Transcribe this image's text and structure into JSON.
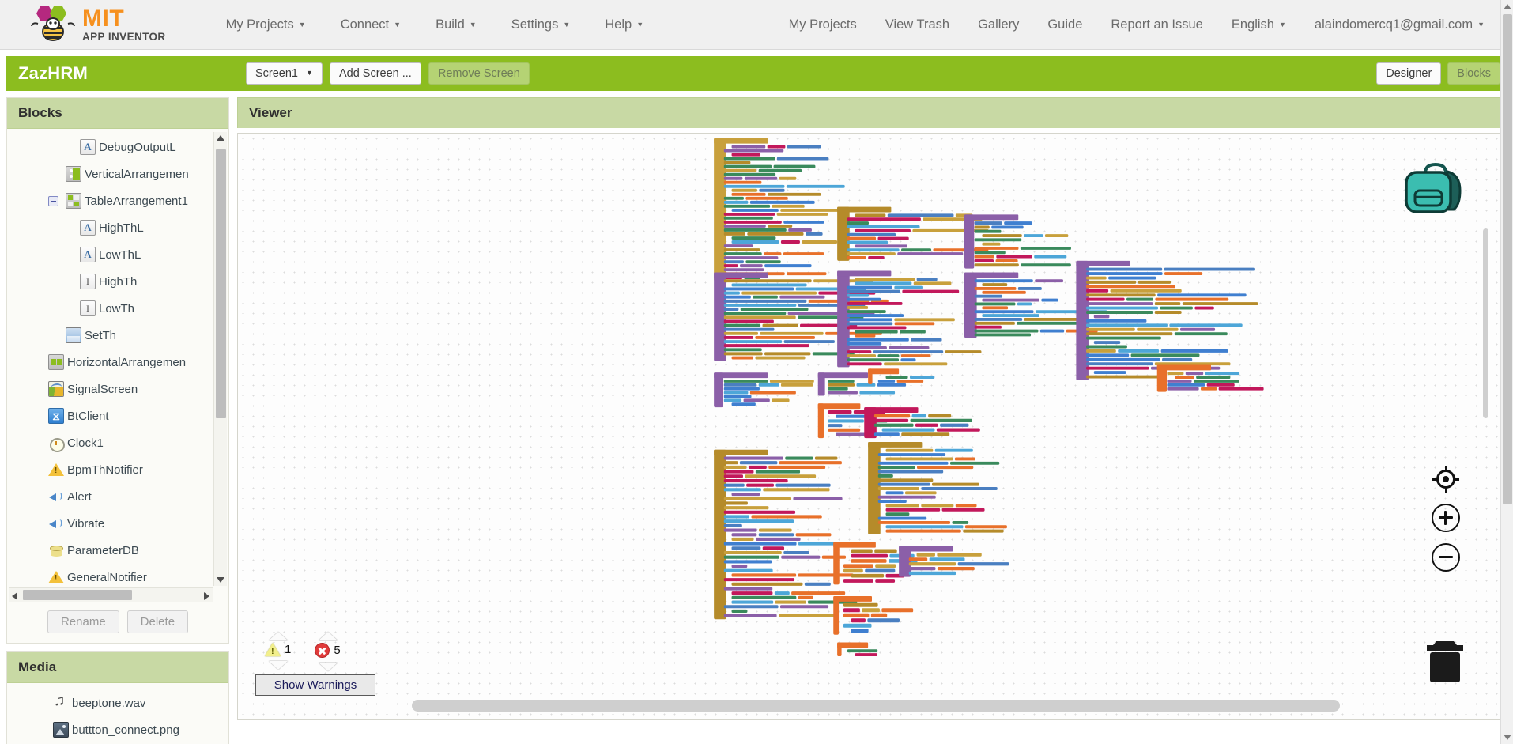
{
  "app": {
    "logo_title": "MIT",
    "logo_subtitle": "APP INVENTOR",
    "logo_icon": "app-inventor-bee-logo"
  },
  "topnav": {
    "left_items": [
      {
        "label": "My Projects",
        "has_caret": true
      },
      {
        "label": "Connect",
        "has_caret": true
      },
      {
        "label": "Build",
        "has_caret": true
      },
      {
        "label": "Settings",
        "has_caret": true
      },
      {
        "label": "Help",
        "has_caret": true
      }
    ],
    "right_items": [
      {
        "label": "My Projects",
        "has_caret": false
      },
      {
        "label": "View Trash",
        "has_caret": false
      },
      {
        "label": "Gallery",
        "has_caret": false
      },
      {
        "label": "Guide",
        "has_caret": false
      },
      {
        "label": "Report an Issue",
        "has_caret": false
      },
      {
        "label": "English",
        "has_caret": true
      },
      {
        "label": "alaindomercq1@gmail.com",
        "has_caret": true
      }
    ]
  },
  "project_bar": {
    "project_name": "ZazHRM",
    "screen_selector": "Screen1",
    "add_screen": "Add Screen ...",
    "remove_screen": "Remove Screen",
    "designer_tab": "Designer",
    "blocks_tab": "Blocks",
    "accent_color": "#8cbd1f"
  },
  "blocks_panel": {
    "title": "Blocks",
    "tree": [
      {
        "label": "DebugOutputL",
        "icon": "label-icon",
        "indent": 3,
        "toggle": false
      },
      {
        "label": "VerticalArrangemen",
        "icon": "vertical-arrangement-icon",
        "indent": 2,
        "toggle": false
      },
      {
        "label": "TableArrangement1",
        "icon": "table-arrangement-icon",
        "indent": 2,
        "toggle": true
      },
      {
        "label": "HighThL",
        "icon": "label-icon",
        "indent": 3,
        "toggle": false
      },
      {
        "label": "LowThL",
        "icon": "label-icon",
        "indent": 3,
        "toggle": false
      },
      {
        "label": "HighTh",
        "icon": "textbox-icon",
        "indent": 3,
        "toggle": false
      },
      {
        "label": "LowTh",
        "icon": "textbox-icon",
        "indent": 3,
        "toggle": false
      },
      {
        "label": "SetTh",
        "icon": "image-icon",
        "indent": 2,
        "toggle": false
      },
      {
        "label": "HorizontalArrangemen",
        "icon": "horizontal-arrangement-icon",
        "indent": 1,
        "toggle": false
      },
      {
        "label": "SignalScreen",
        "icon": "canvas-icon",
        "indent": 1,
        "toggle": false
      },
      {
        "label": "BtClient",
        "icon": "bluetooth-icon",
        "indent": 1,
        "toggle": false
      },
      {
        "label": "Clock1",
        "icon": "clock-icon",
        "indent": 1,
        "toggle": false
      },
      {
        "label": "BpmThNotifier",
        "icon": "notifier-icon",
        "indent": 1,
        "toggle": false
      },
      {
        "label": "Alert",
        "icon": "sound-icon",
        "indent": 1,
        "toggle": false
      },
      {
        "label": "Vibrate",
        "icon": "sound-icon",
        "indent": 1,
        "toggle": false
      },
      {
        "label": "ParameterDB",
        "icon": "database-icon",
        "indent": 1,
        "toggle": false
      },
      {
        "label": "GeneralNotifier",
        "icon": "notifier-icon",
        "indent": 1,
        "toggle": false
      }
    ],
    "rename_button": "Rename",
    "delete_button": "Delete"
  },
  "media_panel": {
    "title": "Media",
    "items": [
      {
        "label": "beeptone.wav",
        "icon": "audio-file-icon"
      },
      {
        "label": "buttton_connect.png",
        "icon": "image-file-icon"
      }
    ]
  },
  "viewer": {
    "title": "Viewer",
    "warnings": {
      "warning_count": "1",
      "error_count": "5",
      "show_warnings_button": "Show Warnings",
      "warning_icon": "warning-triangle-icon",
      "error_icon": "error-circle-icon"
    },
    "tools": {
      "backpack": "backpack-icon",
      "center": "center-blocks-icon",
      "zoom_in": "zoom-in-icon",
      "zoom_out": "zoom-out-icon",
      "trash": "trash-can-icon"
    },
    "block_palette": {
      "control": "#b58b2a",
      "event": "#c8a03c",
      "procedure": "#8b5fa8",
      "setter": "#e8702a",
      "text": "#3a8a5c",
      "logic": "#4a7fc1",
      "math": "#3f7fd0",
      "list": "#4da6d8",
      "color": "#c2185b",
      "variable": "#e8702a"
    }
  }
}
